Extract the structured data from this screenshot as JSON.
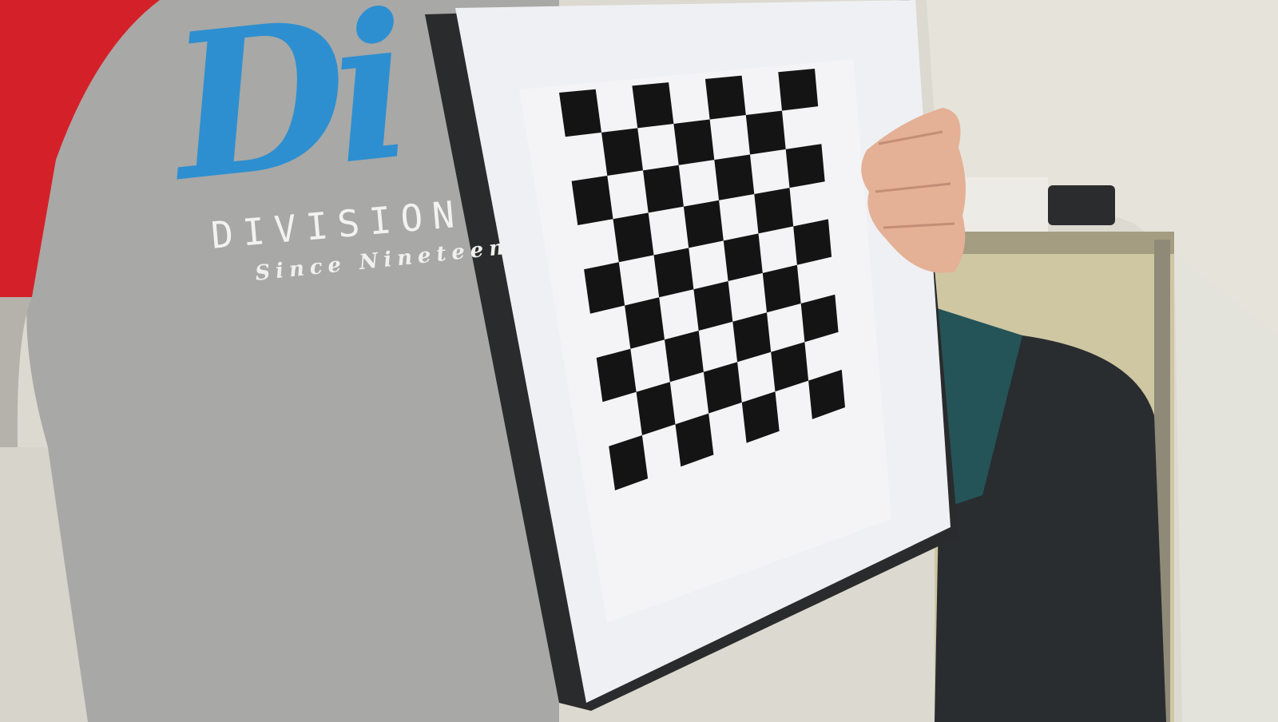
{
  "scene": {
    "description_free": true,
    "shirt_print": {
      "brand": "Di",
      "line1": "DIVISION",
      "line2": "Since Nineteen"
    },
    "calibration_board": {
      "rows": 9,
      "cols": 7
    },
    "colors": {
      "shirt_gray": "#a7a7a5",
      "sleeve_red": "#d9232a",
      "brand_blue": "#2d8fd0",
      "wall": "#d8d6cc",
      "board_frame": "#2b2b2b",
      "mat_white": "#f2f2f4",
      "square_black": "#141414"
    }
  }
}
